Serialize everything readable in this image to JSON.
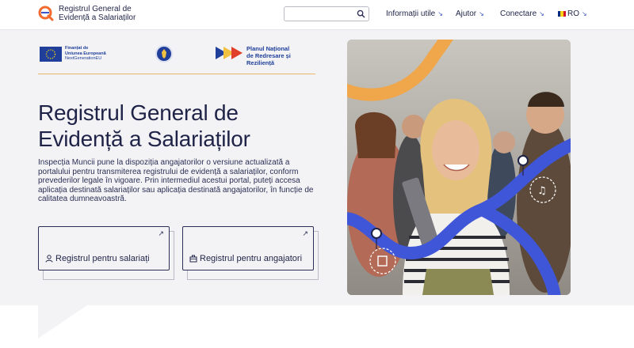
{
  "header": {
    "logo_line1": "Registrul General de",
    "logo_line2": "Evidență a Salariaților",
    "search_placeholder": "",
    "nav": [
      {
        "label": "Informații utile",
        "arrow": "↘"
      },
      {
        "label": "Ajutor",
        "arrow": "↘"
      },
      {
        "label": "Conectare",
        "arrow": "↘"
      },
      {
        "label": "RO",
        "arrow": "↘"
      }
    ]
  },
  "funding": {
    "eu_line1": "Finanțat de",
    "eu_line2": "Uniunea Europeană",
    "eu_line3": "NextGenerationEU",
    "pnrr_line1": "Planul Național",
    "pnrr_line2": "de Redresare și Reziliență"
  },
  "hero": {
    "title": "Registrul General de Evidență a Salariaților",
    "description": "Inspecția Muncii pune la dispoziția angajatorilor o versiune actualizată a portalului pentru transmiterea registrului de evidență a salariaților, conform prevederilor legale în vigoare. Prin intermediul acestui portal, puteți accesa aplicația destinată salariaților sau aplicația destinată angajatorilor, în funcție de calitatea dumneavoastră.",
    "cards": [
      {
        "label": "Registrul pentru salariați",
        "icon": "person-icon",
        "arrow": "↗"
      },
      {
        "label": "Registrul pentru angajatori",
        "icon": "briefcase-icon",
        "arrow": "↗"
      }
    ]
  },
  "colors": {
    "brand_navy": "#1f2347",
    "accent_blue": "#3a55c8",
    "accent_orange": "#f0a64a",
    "hero_bg": "#f3f3f5"
  }
}
